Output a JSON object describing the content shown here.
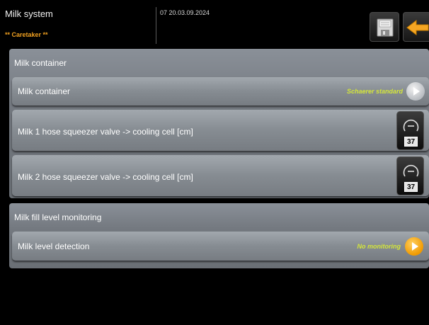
{
  "header": {
    "title": "Milk system",
    "role": "** Caretaker **",
    "datetime": "07 20.03.09.2024"
  },
  "icons": {
    "save": "save-icon",
    "back": "back-arrow-icon",
    "play": "play-icon",
    "dial": "dial-icon"
  },
  "colors": {
    "accent_orange": "#f0a020",
    "value_green": "#d4e63a",
    "panel_grey": "#73787f"
  },
  "sections": [
    {
      "title": "Milk container",
      "rows": [
        {
          "label": "Milk container",
          "value": "Schaerer standard",
          "control": "play-grey"
        },
        {
          "label": "Milk 1 hose squeezer valve -> cooling cell [cm]",
          "value": "37",
          "control": "dial"
        },
        {
          "label": "Milk 2 hose squeezer valve -> cooling cell [cm]",
          "value": "37",
          "control": "dial"
        }
      ]
    },
    {
      "title": "Milk fill level monitoring",
      "rows": [
        {
          "label": "Milk level detection",
          "value": "No monitoring",
          "control": "play-orange"
        }
      ]
    }
  ]
}
